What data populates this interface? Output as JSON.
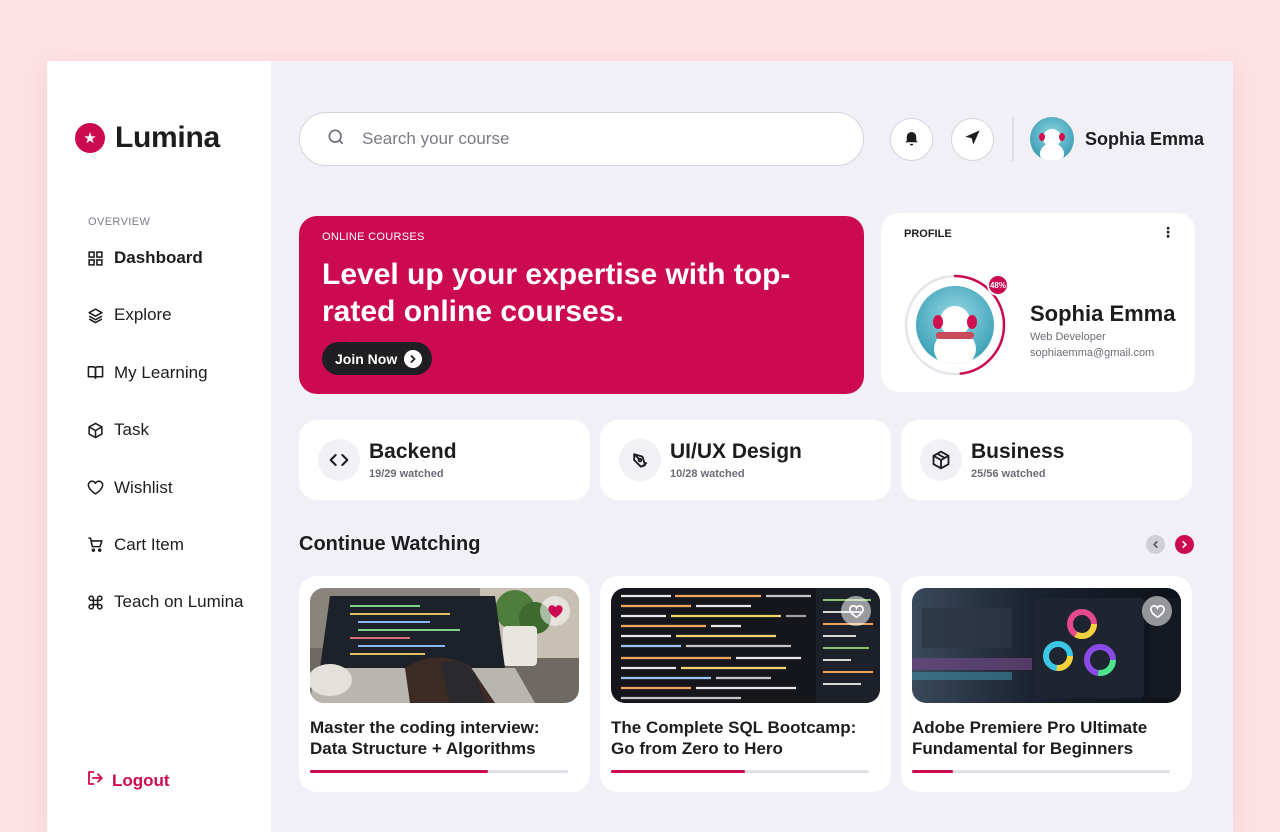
{
  "brand": {
    "name": "Lumina",
    "logo_icon": "star-icon",
    "accent": "#cc0a4f"
  },
  "sidebar": {
    "section_label": "OVERVIEW",
    "items": [
      {
        "label": "Dashboard",
        "icon": "grid-icon",
        "active": true
      },
      {
        "label": "Explore",
        "icon": "layers-icon"
      },
      {
        "label": "My Learning",
        "icon": "book-icon"
      },
      {
        "label": "Task",
        "icon": "box-icon"
      },
      {
        "label": "Wishlist",
        "icon": "heart-icon"
      },
      {
        "label": "Cart Item",
        "icon": "cart-icon"
      },
      {
        "label": "Teach on Lumina",
        "icon": "command-icon"
      }
    ],
    "logout_label": "Logout"
  },
  "topbar": {
    "search_placeholder": "Search your course",
    "user_name": "Sophia Emma"
  },
  "hero": {
    "kicker": "ONLINE COURSES",
    "headline": "Level up your expertise with top-rated online courses.",
    "cta_label": "Join Now"
  },
  "profile": {
    "label": "PROFILE",
    "menu_glyph": "⋮",
    "progress_percent": 48,
    "progress_label": "48%",
    "name": "Sophia Emma",
    "role": "Web Developer",
    "email": "sophiaemma@gmail.com"
  },
  "categories": [
    {
      "title": "Backend",
      "watched": "19/29 watched",
      "icon": "code-icon"
    },
    {
      "title": "UI/UX Design",
      "watched": "10/28 watched",
      "icon": "pen-tool-icon"
    },
    {
      "title": "Business",
      "watched": "25/56 watched",
      "icon": "package-icon"
    }
  ],
  "continue_watching": {
    "title": "Continue Watching",
    "courses": [
      {
        "title": "Master the coding interview: Data Structure + Algorithms",
        "progress": 0.69,
        "favorited": true
      },
      {
        "title": "The Complete SQL Bootcamp: Go from Zero to Hero",
        "progress": 0.52,
        "favorited": false
      },
      {
        "title": "Adobe Premiere Pro Ultimate Fundamental for Beginners",
        "progress": 0.16,
        "favorited": false
      }
    ]
  }
}
